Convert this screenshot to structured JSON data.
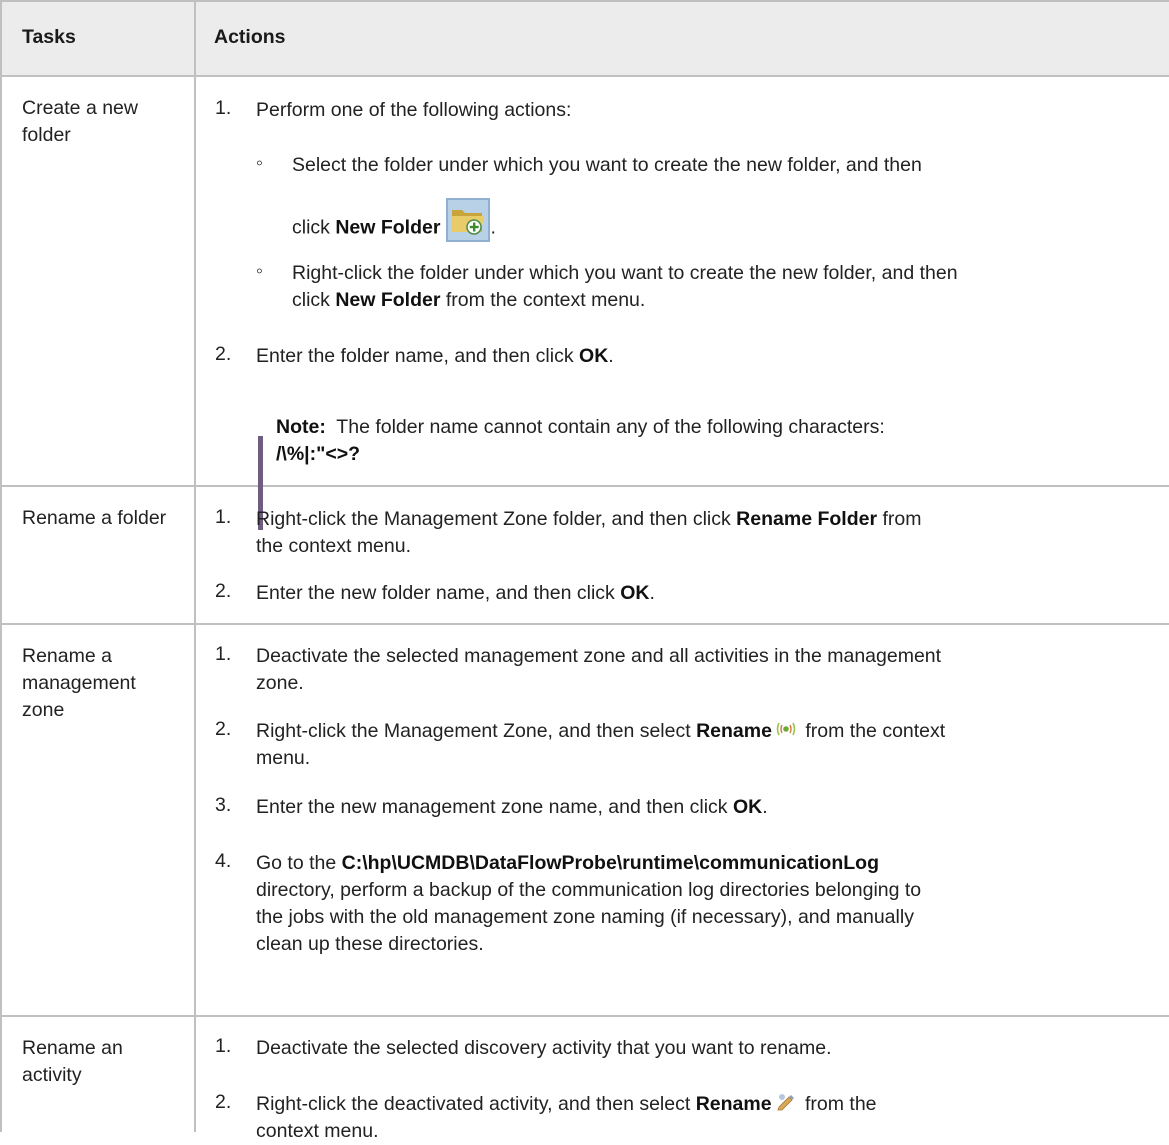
{
  "header": {
    "tasks": "Tasks",
    "actions": "Actions"
  },
  "rows": [
    {
      "task": "Create a new folder",
      "step1": {
        "num": "1.",
        "text": "Perform one of the following actions:"
      },
      "bullet1": {
        "line1": "Select the folder under which you want to create the new folder, and then",
        "pre": "click ",
        "bold": "New Folder",
        "post": "."
      },
      "bullet2": {
        "line1": "Right-click the folder under which you want to create the new folder, and then",
        "pre": "click ",
        "bold": "New Folder",
        "post": " from the context menu."
      },
      "step2": {
        "num": "2.",
        "pre": "Enter the folder name, and then click ",
        "bold": "OK",
        "post": "."
      },
      "note": {
        "label": "Note:",
        "text": "  The folder name cannot contain any of the following characters:",
        "chars": "/\\%|:\"<>?"
      }
    },
    {
      "task": "Rename a folder",
      "step1": {
        "num": "1.",
        "pre": "Right-click the Management Zone folder, and then click ",
        "bold": "Rename Folder",
        "post": " from",
        "line2": "the context menu."
      },
      "step2": {
        "num": "2.",
        "pre": "Enter the new folder name, and then click ",
        "bold": "OK",
        "post": "."
      }
    },
    {
      "task": "Rename a management zone",
      "step1": {
        "num": "1.",
        "line1": "Deactivate the selected management zone and all activities in the management",
        "line2": "zone."
      },
      "step2": {
        "num": "2.",
        "pre": "Right-click the Management Zone, and then select ",
        "bold": "Rename",
        "post": " from the context",
        "line2": "menu."
      },
      "step3": {
        "num": "3.",
        "pre": "Enter the new management zone name, and then click ",
        "bold": "OK",
        "post": "."
      },
      "step4": {
        "num": "4.",
        "pre": "Go to the ",
        "bold": "C:\\hp\\UCMDB\\DataFlowProbe\\runtime\\communicationLog",
        "line2": "directory, perform a backup of the communication log directories belonging to",
        "line3": "the jobs with the old management zone naming (if necessary), and manually",
        "line4": "clean up these directories."
      }
    },
    {
      "task": "Rename an activity",
      "step1": {
        "num": "1.",
        "text": "Deactivate the selected discovery activity that you want to rename."
      },
      "step2": {
        "num": "2.",
        "pre": "Right-click the deactivated activity, and then select ",
        "bold": "Rename",
        "post": " from the",
        "line2": "context menu."
      }
    }
  ],
  "icons": {
    "new_folder": "new-folder-icon",
    "rename_zone": "rename-zone-icon",
    "rename_activity": "rename-activity-icon"
  },
  "colors": {
    "header_bg": "#ececec",
    "border": "#c0c0c0",
    "note_bar": "#6e5d7e"
  }
}
